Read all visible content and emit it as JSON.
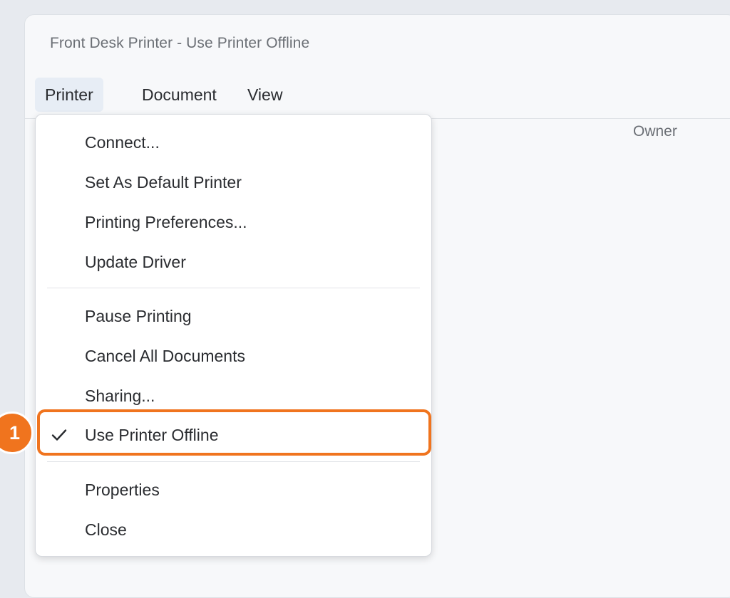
{
  "window": {
    "title": "Front Desk Printer - Use Printer Offline"
  },
  "menubar": {
    "items": [
      {
        "label": "Printer",
        "active": true
      },
      {
        "label": "Document",
        "active": false
      },
      {
        "label": "View",
        "active": false
      }
    ]
  },
  "list_header": {
    "owner": "Owner"
  },
  "printer_menu": {
    "items": [
      {
        "label": "Connect..."
      },
      {
        "label": "Set As Default Printer"
      },
      {
        "label": "Printing Preferences..."
      },
      {
        "label": "Update Driver"
      },
      {
        "label": "Pause Printing"
      },
      {
        "label": "Cancel All Documents"
      },
      {
        "label": "Sharing..."
      },
      {
        "label": "Use Printer Offline",
        "checked": true,
        "highlighted": true
      },
      {
        "label": "Properties"
      },
      {
        "label": "Close"
      }
    ]
  },
  "annotation": {
    "step_number": "1",
    "color": "#f0741e"
  },
  "icons": {
    "checkmark": "checkmark-icon"
  }
}
